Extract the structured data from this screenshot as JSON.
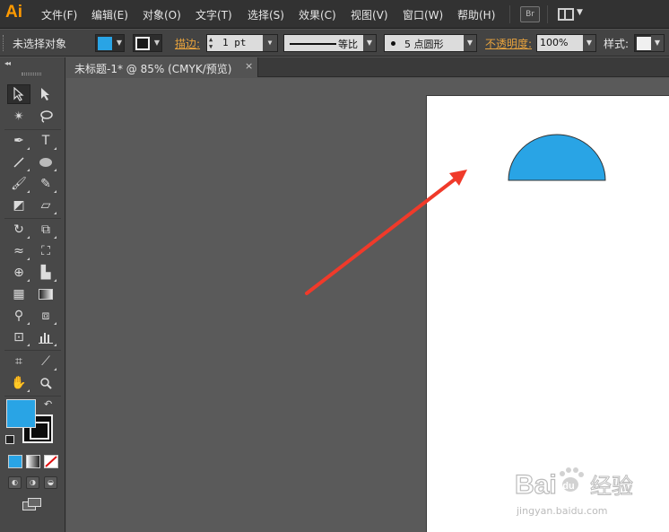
{
  "app": {
    "logo": "Ai"
  },
  "menu": {
    "items": [
      "文件(F)",
      "编辑(E)",
      "对象(O)",
      "文字(T)",
      "选择(S)",
      "效果(C)",
      "视图(V)",
      "窗口(W)",
      "帮助(H)"
    ],
    "bridge_label": "Br"
  },
  "control": {
    "selection_status": "未选择对象",
    "fill_color": "#29a4e5",
    "stroke_label": "描边:",
    "stroke_weight": "1 pt",
    "stroke_style": "等比",
    "brush": "5 点圆形",
    "opacity_label": "不透明度:",
    "opacity": "100%",
    "style_label": "样式:"
  },
  "document": {
    "tab_title": "未标题-1* @ 85% (CMYK/预览)",
    "close_glyph": "×"
  },
  "shape": {
    "type": "semicircle",
    "fill": "#29a4e5",
    "stroke": "#333333"
  },
  "annotation": {
    "arrow_color": "#f03a2a"
  },
  "colors": {
    "accent": "#ff9a00",
    "fill": "#29a4e5",
    "stroke": "#000000"
  },
  "watermark": {
    "line1": "Bai",
    "line2": "经验",
    "url": "jingyan.baidu.com"
  }
}
